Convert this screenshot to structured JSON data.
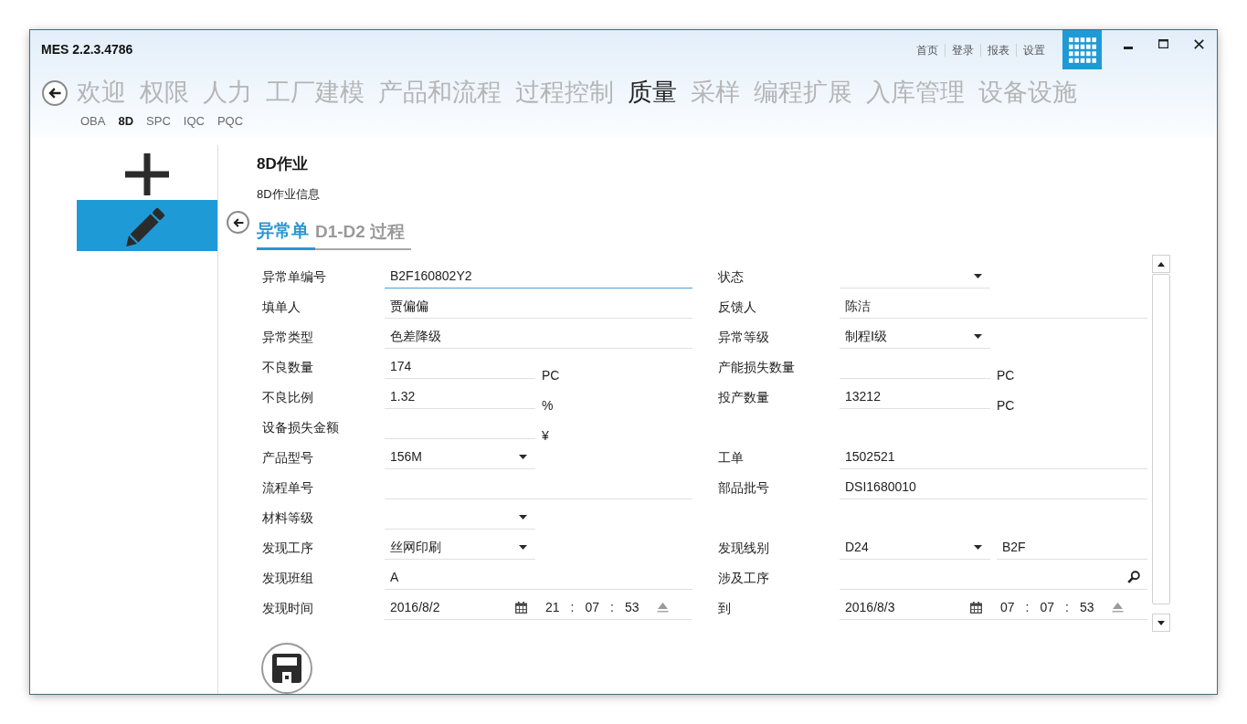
{
  "window": {
    "title": "MES 2.2.3.4786",
    "top_links": [
      "首页",
      "登录",
      "报表",
      "设置"
    ]
  },
  "main_nav": [
    {
      "label": "欢迎",
      "selected": false
    },
    {
      "label": "权限",
      "selected": false
    },
    {
      "label": "人力",
      "selected": false
    },
    {
      "label": "工厂建模",
      "selected": false
    },
    {
      "label": "产品和流程",
      "selected": false
    },
    {
      "label": "过程控制",
      "selected": false
    },
    {
      "label": "质量",
      "selected": true
    },
    {
      "label": "采样",
      "selected": false
    },
    {
      "label": "编程扩展",
      "selected": false
    },
    {
      "label": "入库管理",
      "selected": false
    },
    {
      "label": "设备设施",
      "selected": false
    }
  ],
  "sub_nav": [
    {
      "label": "OBA",
      "selected": false
    },
    {
      "label": "8D",
      "selected": true
    },
    {
      "label": "SPC",
      "selected": false
    },
    {
      "label": "IQC",
      "selected": false
    },
    {
      "label": "PQC",
      "selected": false
    }
  ],
  "sidebar": [
    {
      "kind": "add",
      "selected": false
    },
    {
      "kind": "edit",
      "selected": true
    }
  ],
  "page": {
    "title": "8D作业",
    "subtitle": "8D作业信息"
  },
  "tabs": [
    {
      "label": "异常单",
      "selected": true
    },
    {
      "label": "D1-D2 过程",
      "selected": false
    }
  ],
  "form": {
    "rows": [
      {
        "left": {
          "label": "异常单编号",
          "kind": "text",
          "value": "B2F160802Y2",
          "focused": true
        },
        "right": {
          "label": "状态",
          "kind": "dropdown",
          "focused": false
        }
      },
      {
        "left": {
          "label": "填单人",
          "kind": "text",
          "value": "贾偏偏",
          "focused": false
        },
        "right": {
          "label": "反馈人",
          "kind": "text",
          "value": "陈洁",
          "focused": false
        }
      },
      {
        "left": {
          "label": "异常类型",
          "kind": "text",
          "value": "色差降级",
          "focused": false
        },
        "right": {
          "label": "异常等级",
          "kind": "dropdown",
          "value": "制程Ⅰ级",
          "focused": false
        }
      },
      {
        "left": {
          "label": "不良数量",
          "kind": "unit",
          "value": "174",
          "unit": "PC",
          "focused": false
        },
        "right": {
          "label": "产能损失数量",
          "kind": "unit",
          "unit": "PC",
          "focused": false
        }
      },
      {
        "left": {
          "label": "不良比例",
          "kind": "unit",
          "value": "1.32",
          "unit": "%",
          "focused": false
        },
        "right": {
          "label": "投产数量",
          "kind": "unit",
          "value": "13212",
          "unit": "PC",
          "focused": false
        }
      },
      {
        "left": {
          "label": "设备损失金额",
          "kind": "unit",
          "unit": "¥",
          "focused": false
        }
      },
      {
        "left": {
          "label": "产品型号",
          "kind": "dropdown",
          "value": "156M",
          "focused": false
        },
        "right": {
          "label": "工单",
          "kind": "text",
          "value": "1502521",
          "focused": false
        }
      },
      {
        "left": {
          "label": "流程单号",
          "kind": "text",
          "focused": false
        },
        "right": {
          "label": "部品批号",
          "kind": "text",
          "value": "DSI1680010",
          "focused": false
        }
      },
      {
        "left": {
          "label": "材料等级",
          "kind": "dropdown",
          "focused": false
        }
      },
      {
        "left": {
          "label": "发现工序",
          "kind": "dropdown",
          "value": "丝网印刷",
          "focused": false
        },
        "right": {
          "label": "发现线别",
          "kind": "combo",
          "value": "D24",
          "extra": "B2F",
          "focused": false
        }
      },
      {
        "left": {
          "label": "发现班组",
          "kind": "text",
          "value": "A",
          "focused": false
        },
        "right": {
          "label": "涉及工序",
          "kind": "search",
          "focused": false
        }
      },
      {
        "left": {
          "label": "发现时间",
          "kind": "datetime",
          "date": "2016/8/2",
          "time_parts": [
            "21",
            ":",
            "07",
            ":",
            "53"
          ],
          "focused": false
        },
        "right": {
          "label": "到",
          "kind": "datetime",
          "date": "2016/8/3",
          "time_parts": [
            "07",
            ":",
            "07",
            ":",
            "53"
          ],
          "focused": false
        }
      }
    ]
  }
}
